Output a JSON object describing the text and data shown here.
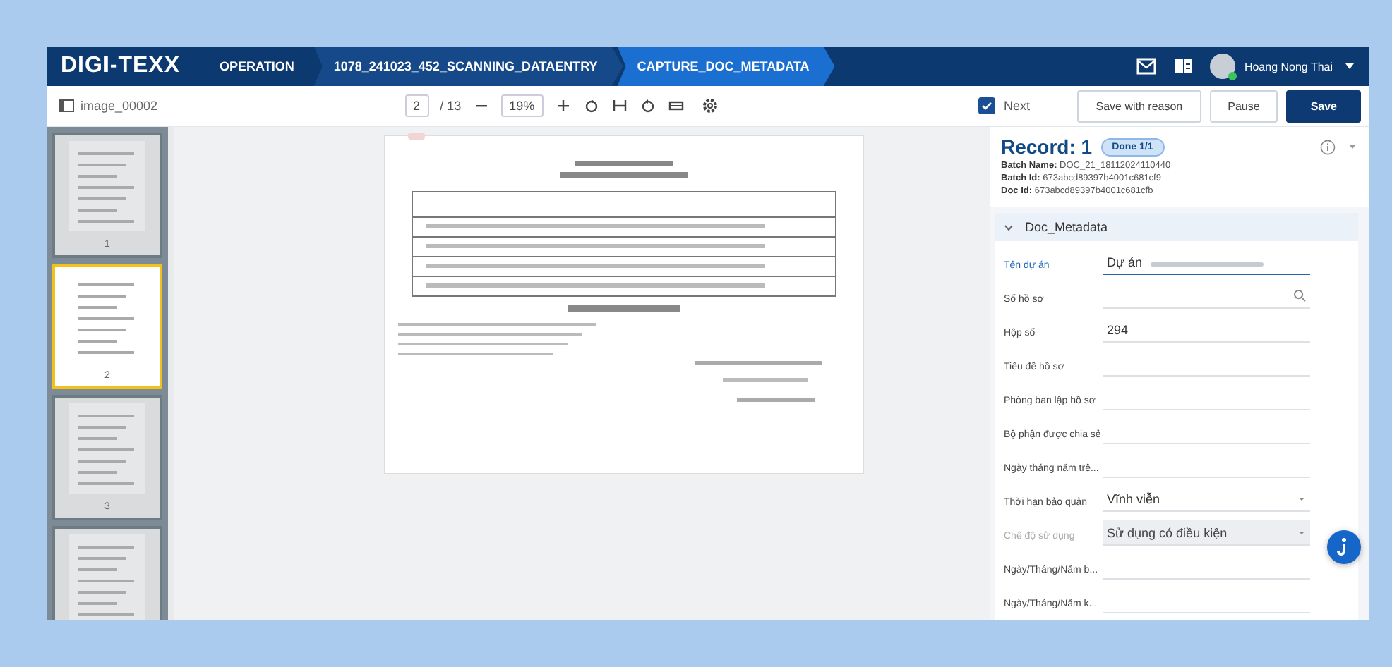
{
  "header": {
    "logo": "DIGI-TEXX",
    "breadcrumbs": [
      {
        "label": "OPERATION",
        "selected": false
      },
      {
        "label": "1078_241023_452_SCANNING_DATAENTRY",
        "selected": false
      },
      {
        "label": "CAPTURE_DOC_METADATA",
        "selected": true
      }
    ],
    "user": {
      "name": "Hoang Nong Thai",
      "online": true
    }
  },
  "toolbar": {
    "file_name": "image_00002",
    "page": "2",
    "page_total": "/ 13",
    "zoom": "19%"
  },
  "actions": {
    "next": {
      "label": "Next",
      "checked": true
    },
    "buttons": [
      {
        "label": "Save with reason",
        "kind": "secondary"
      },
      {
        "label": "Pause",
        "kind": "secondary"
      },
      {
        "label": "Save",
        "kind": "primary"
      }
    ]
  },
  "thumbnails": [
    {
      "page": "1",
      "selected": false
    },
    {
      "page": "2",
      "selected": true
    },
    {
      "page": "3",
      "selected": false
    },
    {
      "selected": false
    }
  ],
  "record": {
    "title": "Record: 1",
    "status": "Done 1/1",
    "meta": [
      {
        "label": "Batch Name:",
        "value": "DOC_21_18112024110440"
      },
      {
        "label": "Batch Id:",
        "value": "673abcd89397b4001c681cf9"
      },
      {
        "label": "Doc Id:",
        "value": "673abcd89397b4001c681cfb"
      }
    ]
  },
  "section": {
    "title": "Doc_Metadata",
    "expanded": true,
    "fields": [
      {
        "label": "Tên dự án",
        "value": "Dự án",
        "kind": "text",
        "focused": true,
        "disabled": false
      },
      {
        "label": "Số hồ sơ",
        "kind": "search",
        "focused": false,
        "disabled": false
      },
      {
        "label": "Hộp số",
        "value": "294",
        "kind": "text",
        "focused": false,
        "disabled": false
      },
      {
        "label": "Tiêu đề hồ sơ",
        "kind": "text",
        "focused": false,
        "disabled": false
      },
      {
        "label": "Phòng ban lập hồ sơ",
        "kind": "text",
        "focused": false,
        "disabled": false
      },
      {
        "label": "Bộ phận được chia sẻ",
        "kind": "text",
        "focused": false,
        "disabled": false
      },
      {
        "label": "Ngày tháng năm trê...",
        "kind": "text",
        "focused": false,
        "disabled": false
      },
      {
        "label": "Thời hạn bảo quản",
        "value": "Vĩnh viễn",
        "kind": "select",
        "focused": false,
        "disabled": false
      },
      {
        "label": "Chế độ sử dụng",
        "value": "Sử dụng có điều kiện",
        "kind": "select",
        "focused": false,
        "disabled": true
      },
      {
        "label": "Ngày/Tháng/Năm b...",
        "kind": "text",
        "focused": false,
        "disabled": false
      },
      {
        "label": "Ngày/Tháng/Năm k...",
        "kind": "text",
        "focused": false,
        "disabled": false
      }
    ]
  }
}
